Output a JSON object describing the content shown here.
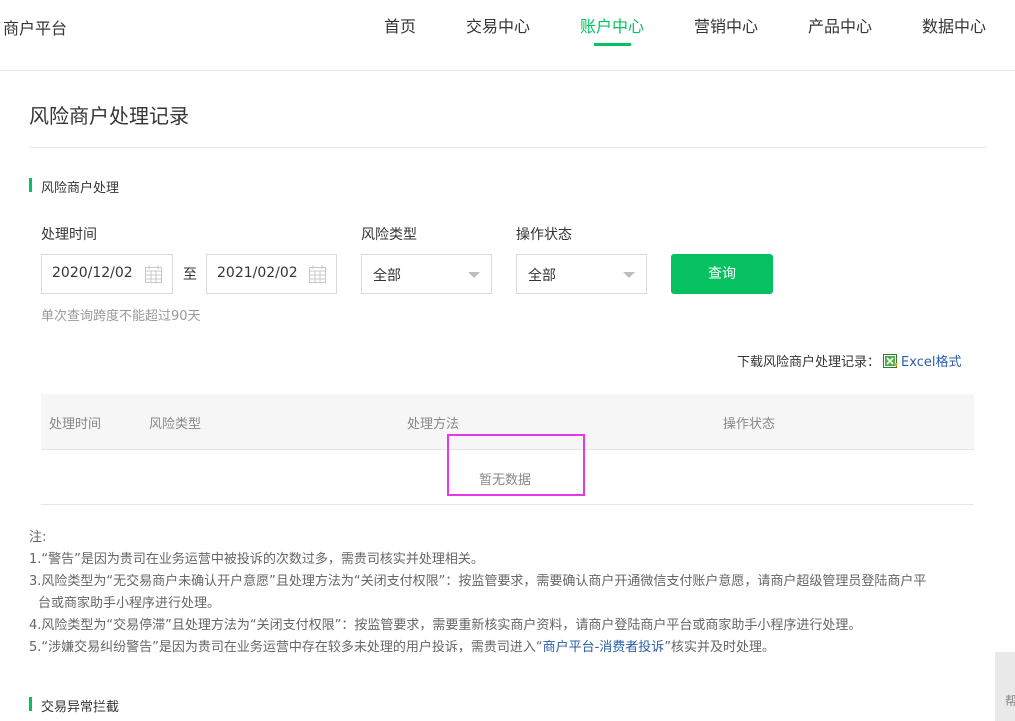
{
  "header": {
    "brand": "商户平台",
    "nav": [
      "首页",
      "交易中心",
      "账户中心",
      "营销中心",
      "产品中心",
      "数据中心"
    ],
    "active_nav": "账户中心"
  },
  "page_title": "风险商户处理记录",
  "section1": {
    "title": "风险商户处理",
    "filters": {
      "time_label": "处理时间",
      "start_date": "2020/12/02",
      "to_label": "至",
      "end_date": "2021/02/02",
      "risk_type_label": "风险类型",
      "risk_type_value": "全部",
      "status_label": "操作状态",
      "status_value": "全部",
      "query_button": "查询",
      "hint": "单次查询跨度不能超过90天"
    },
    "download": {
      "label": "下载风险商户处理记录：",
      "link": "Excel格式"
    },
    "table": {
      "columns": [
        "处理时间",
        "风险类型",
        "处理方法",
        "操作状态"
      ],
      "empty": "暂无数据"
    },
    "notes": {
      "heading": "注:",
      "n1": "1.“警告”是因为贵司在业务运营中被投诉的次数过多，需贵司核实并处理相关。",
      "n3_line1": "3.风险类型为“无交易商户未确认开户意愿”且处理方法为“关闭支付权限”：按监管要求，需要确认商户开通微信支付账户意愿，请商户超级管理员登陆商户平",
      "n3_line2": "台或商家助手小程序进行处理。",
      "n4": "4.风险类型为“交易停滞”且处理方法为“关闭支付权限”：按监管要求，需要重新核实商户资料，请商户登陆商户平台或商家助手小程序进行处理。",
      "n5_before": "5.“涉嫌交易纠纷警告”是因为贵司在业务运营中存在较多未处理的用户投诉，需贵司进入“",
      "n5_link": "商户平台-消费者投诉",
      "n5_after": "”核实并及时处理。"
    }
  },
  "section2": {
    "title": "交易异常拦截"
  },
  "side_help": "帮",
  "colors": {
    "accent": "#07c160",
    "link": "#2b5fa6",
    "highlight": "#e23ae6"
  }
}
